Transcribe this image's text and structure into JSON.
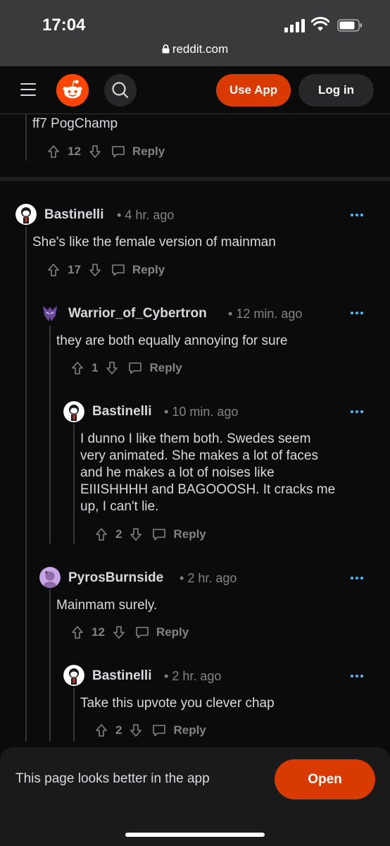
{
  "status": {
    "time": "17:04",
    "url": "reddit.com"
  },
  "header": {
    "use_app": "Use App",
    "login": "Log in"
  },
  "colors": {
    "accent": "#d93a00",
    "reddit_orange": "#ff4500",
    "link_blue": "#4fbcff"
  },
  "comments": [
    {
      "body": "ff7 PogChamp",
      "score": "12",
      "reply": "Reply"
    },
    {
      "author": "Bastinelli",
      "time": "4 hr. ago",
      "body": "She's like the female version of mainman",
      "score": "17",
      "reply": "Reply",
      "avatar_icon": "snoo-avatar-icon"
    },
    {
      "author": "Warrior_of_Cybertron",
      "time": "12 min. ago",
      "body": "they are both equally annoying for sure",
      "score": "1",
      "reply": "Reply",
      "avatar_icon": "decepticon-avatar-icon"
    },
    {
      "author": "Bastinelli",
      "time": "10 min. ago",
      "body_lines": [
        "I dunno I like them both. Swedes seem",
        "very animated. She makes a lot of faces",
        "and he makes a lot of noises like",
        "EIIISHHHH and BAGOOOSH. It cracks me",
        "up, I can't lie."
      ],
      "score": "2",
      "reply": "Reply",
      "avatar_icon": "snoo-avatar-icon"
    },
    {
      "author": "PyrosBurnside",
      "time": "2 hr. ago",
      "body": "Mainmam surely.",
      "score": "12",
      "reply": "Reply",
      "avatar_icon": "snoo-avatar-icon"
    },
    {
      "author": "Bastinelli",
      "time": "2 hr. ago",
      "body": "Take this upvote you clever chap",
      "score": "2",
      "reply": "Reply",
      "avatar_icon": "snoo-avatar-icon"
    }
  ],
  "banner": {
    "text": "This page looks better in the app",
    "open": "Open"
  }
}
